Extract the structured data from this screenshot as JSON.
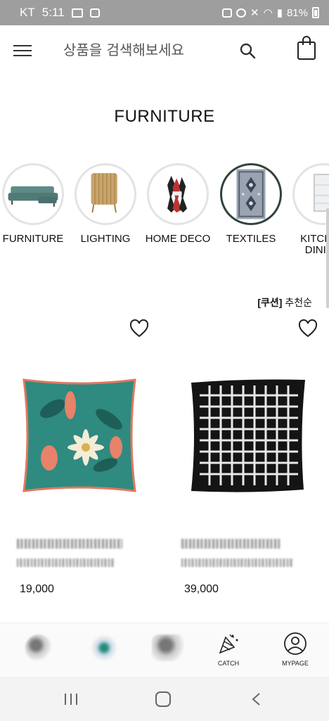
{
  "status_bar": {
    "carrier": "KT",
    "time": "5:11",
    "battery": "81%"
  },
  "header": {
    "search_placeholder": "상품을 검색해보세요"
  },
  "page_title": "FURNITURE",
  "categories": [
    {
      "label": "FURNITURE",
      "active": false
    },
    {
      "label": "LIGHTING",
      "active": false
    },
    {
      "label": "HOME DECO",
      "active": false
    },
    {
      "label": "TEXTILES",
      "active": true
    },
    {
      "label": "KITCHEN\nDINING",
      "active": false
    }
  ],
  "sort": {
    "category": "[쿠션]",
    "order": "추천순"
  },
  "products": [
    {
      "price": "19,000"
    },
    {
      "price": "39,000"
    }
  ],
  "tab_bar": {
    "catch": "CATCH",
    "mypage": "MYPAGE"
  },
  "colors": {
    "active_circle": "#31433b",
    "status_bar": "#9e9e9e"
  }
}
